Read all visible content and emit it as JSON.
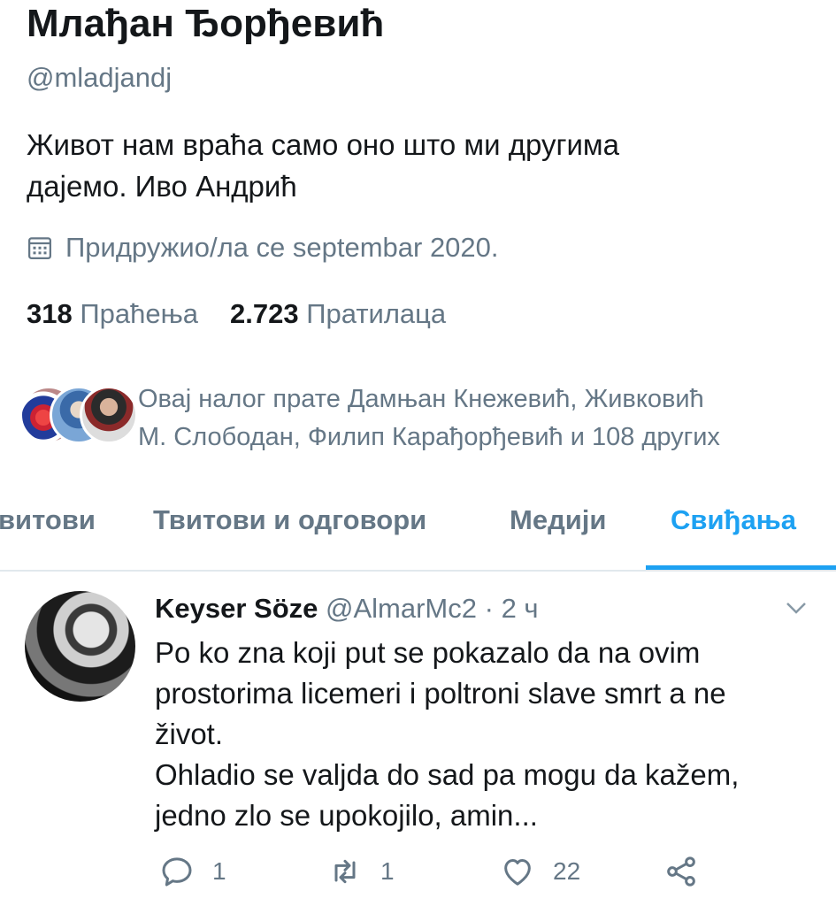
{
  "profile": {
    "name": "Млађан Ђорђевић",
    "handle": "@mladjandj",
    "bio_line1": "Живот нам враћа само оно што ми другима",
    "bio_line2": "дајемо.  Иво Андрић",
    "joined": "Придружио/ла се septembar 2020.",
    "following_count": "318",
    "following_label": "Праћења",
    "followers_count": "2.723",
    "followers_label": "Пратилаца",
    "followed_by_line1": "Овај налог прате Дамњан Кнежевић, Живковић",
    "followed_by_line2": "М. Слободан, Филип Карађорђевић и 108 других"
  },
  "tabs": [
    {
      "label": "витови",
      "active": false
    },
    {
      "label": "Твитови и одговори",
      "active": false
    },
    {
      "label": "Медији",
      "active": false
    },
    {
      "label": "Свиђања",
      "active": true
    }
  ],
  "tweet": {
    "author_name": "Keyser Söze",
    "author_handle": "@AlmarMc2",
    "separator": "·",
    "time": "2 ч",
    "lines": [
      "Po ko zna koji put se pokazalo da na ovim",
      "prostorima licemeri i poltroni slave smrt a ne",
      "život.",
      "Ohladio se valjda do sad pa mogu da kažem,",
      "jedno zlo se upokojilo, amin..."
    ],
    "replies": "1",
    "retweets": "1",
    "likes": "22"
  },
  "colors": {
    "accent": "#1da1f2",
    "text_primary": "#14171a",
    "text_secondary": "#657786",
    "divider": "#e1e8ed"
  },
  "icons": [
    "calendar-icon",
    "chevron-down-icon",
    "reply-icon",
    "retweet-icon",
    "like-icon",
    "share-icon"
  ]
}
